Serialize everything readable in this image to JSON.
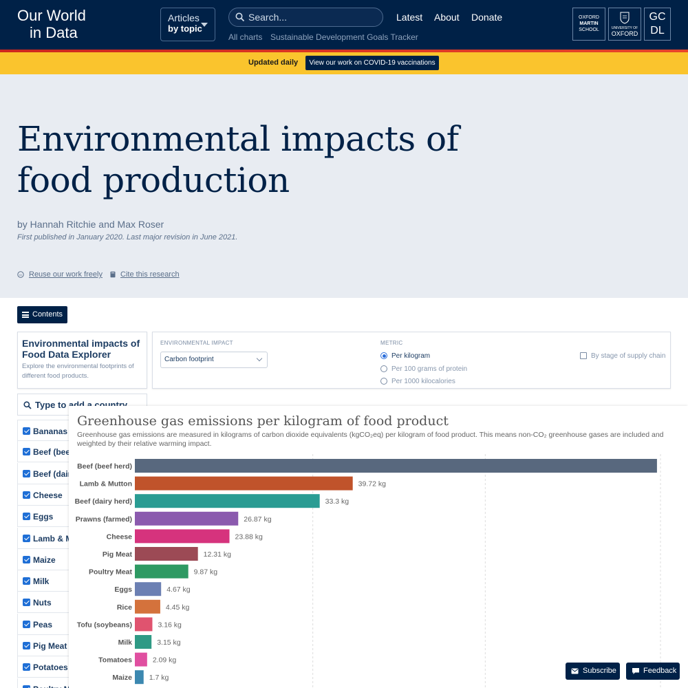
{
  "header": {
    "logo_line1": "Our World",
    "logo_line2": "in Data",
    "articles_line1": "Articles",
    "articles_line2": "by topic",
    "search_placeholder": "Search...",
    "nav": [
      "Latest",
      "About",
      "Donate"
    ],
    "sub_nav": [
      "All charts",
      "Sustainable Development Goals Tracker"
    ],
    "partners": {
      "oms": [
        "OXFORD",
        "MARTIN",
        "SCHOOL"
      ],
      "oxford": [
        "UNIVERSITY OF",
        "OXFORD"
      ],
      "gcdl": [
        "GC",
        "DL"
      ]
    }
  },
  "banner": {
    "updated": "Updated daily",
    "cta": "View our work on COVID-19 vaccinations"
  },
  "hero": {
    "title": "Environmental impacts of food production",
    "byline": "by Hannah Ritchie and Max Roser",
    "published": "First published in January 2020. Last major revision in June 2021.",
    "reuse": "Reuse our work freely",
    "cite": "Cite this research"
  },
  "contents_label": "Contents",
  "explorer": {
    "title": "Environmental impacts of Food Data Explorer",
    "subtitle": "Explore the environmental footprints of different food products.",
    "impact_label": "ENVIRONMENTAL IMPACT",
    "impact_value": "Carbon footprint",
    "metric_label": "METRIC",
    "metrics": [
      "Per kilogram",
      "Per 100 grams of protein",
      "Per 1000 kilocalories"
    ],
    "supply_chain_label": "By stage of supply chain",
    "country_search_placeholder": "Type to add a country",
    "foods": [
      "Bananas",
      "Beef (beef herd)",
      "Beef (dairy herd)",
      "Cheese",
      "Eggs",
      "Lamb & Mutton",
      "Maize",
      "Milk",
      "Nuts",
      "Peas",
      "Pig Meat",
      "Potatoes",
      "Poultry Meat"
    ]
  },
  "chart_data": {
    "type": "bar",
    "title": "Greenhouse gas emissions per kilogram of food product",
    "subtitle": "Greenhouse gas emissions are measured in kilograms of carbon dioxide equivalents (kgCO₂eq) per kilogram of food product. This means non-CO₂ greenhouse gases are included and weighted by their relative warming impact.",
    "orientation": "horizontal",
    "categories": [
      "Beef (beef herd)",
      "Lamb & Mutton",
      "Beef (dairy herd)",
      "Prawns (farmed)",
      "Cheese",
      "Pig Meat",
      "Poultry Meat",
      "Eggs",
      "Rice",
      "Tofu (soybeans)",
      "Milk",
      "Tomatoes",
      "Maize"
    ],
    "values": [
      59.6,
      24.87,
      21.1,
      11.8,
      10.8,
      7.2,
      6.1,
      3.0,
      2.9,
      2.0,
      1.9,
      1.4,
      1.0
    ],
    "value_labels": [
      "",
      "39.72 kg",
      "33.3 kg",
      "26.87 kg",
      "23.88 kg",
      "12.31 kg",
      "9.87 kg",
      "4.67 kg",
      "4.45 kg",
      "3.16 kg",
      "3.15 kg",
      "2.09 kg",
      "1.7 kg"
    ],
    "colors": [
      "#58687e",
      "#c0532b",
      "#2a9c93",
      "#8b5aae",
      "#d6337d",
      "#9c4a55",
      "#2e9a63",
      "#6c80b3",
      "#d4723c",
      "#e0536f",
      "#2f9a85",
      "#e04fa0",
      "#3c88b0"
    ],
    "xlim": [
      0,
      60
    ],
    "grid": true
  },
  "float_buttons": {
    "subscribe": "Subscribe",
    "feedback": "Feedback"
  }
}
